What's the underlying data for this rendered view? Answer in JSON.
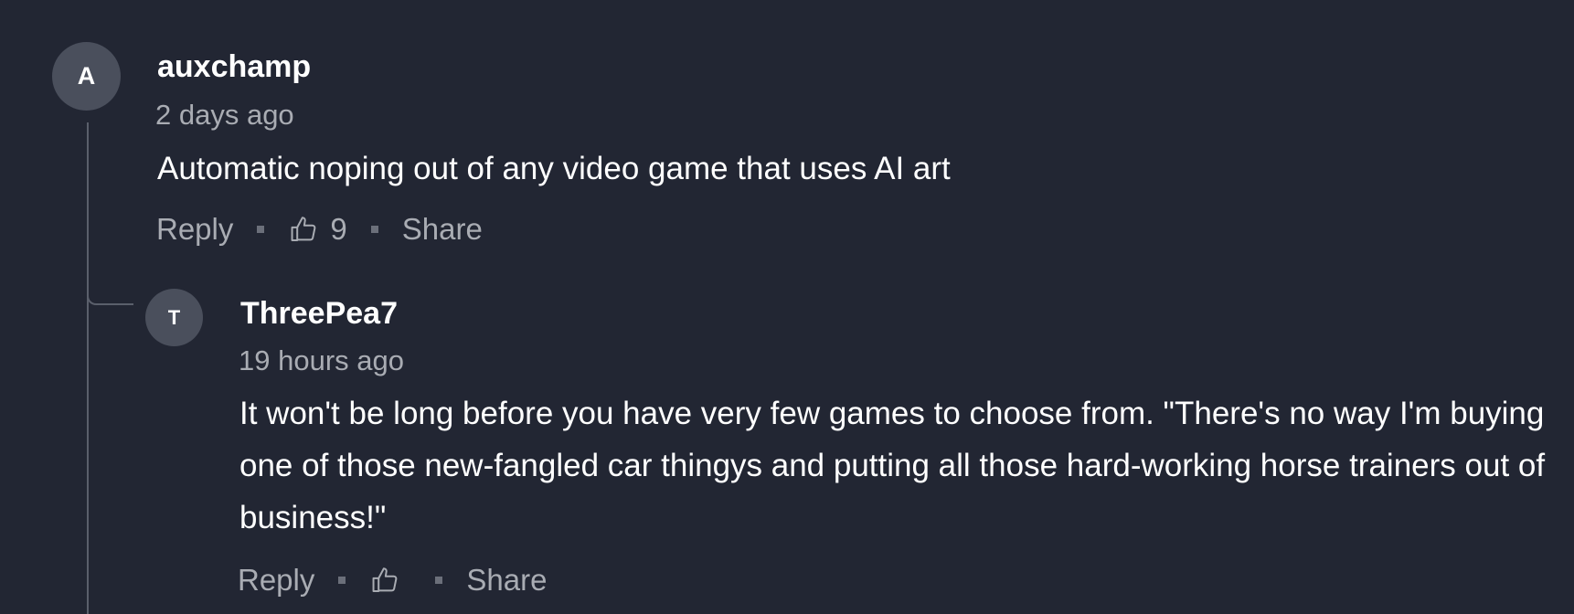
{
  "comments": [
    {
      "avatar_letter": "A",
      "username": "auxchamp",
      "timestamp": "2 days ago",
      "body": "Automatic noping out of any video game that uses AI art",
      "actions": {
        "reply": "Reply",
        "like_count": "9",
        "share": "Share"
      }
    },
    {
      "avatar_letter": "T",
      "username": "ThreePea7",
      "timestamp": "19 hours ago",
      "body": "It won't be long before you have very few games to choose from.  \"There's no way I'm buying one of those new-fangled car thingys and putting all those hard-working horse trainers out of business!\"",
      "actions": {
        "reply": "Reply",
        "like_count": "",
        "share": "Share"
      }
    }
  ],
  "icons": {
    "like": "thumbs-up-icon"
  },
  "colors": {
    "background": "#222633",
    "avatar": "#4a4f5c",
    "muted_text": "#a9acb3",
    "thread_line": "#5a5f6b"
  }
}
